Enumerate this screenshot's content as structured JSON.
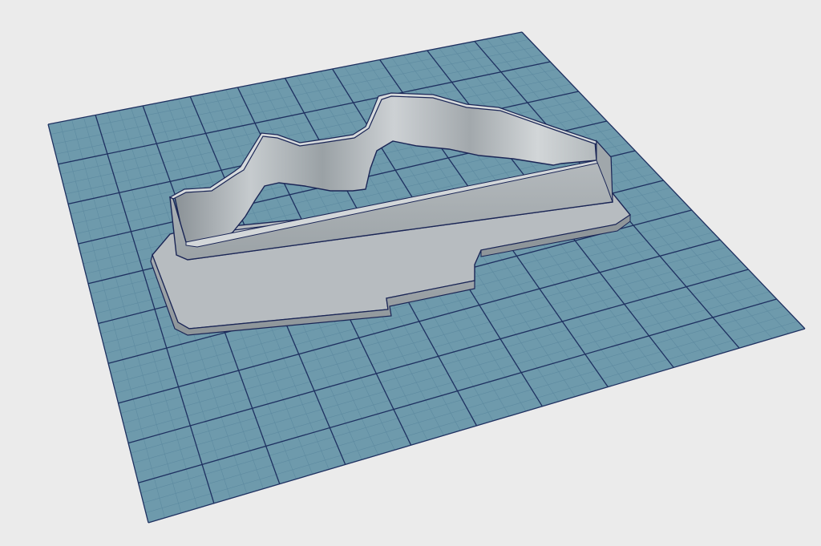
{
  "viewport": {
    "background_color": "#ebebeb"
  },
  "build_plate": {
    "fill_color": "#6e9aac",
    "minor_grid_color": "#5d8aa0",
    "major_grid_color": "#1e3060",
    "major_divisions": 10,
    "minor_per_major": 4
  },
  "model": {
    "name": "cookie-cutter",
    "body_color": "#a9afb3",
    "light_color": "#c9ced1",
    "shade_color": "#7d8589",
    "edge_color": "#1a2555"
  }
}
